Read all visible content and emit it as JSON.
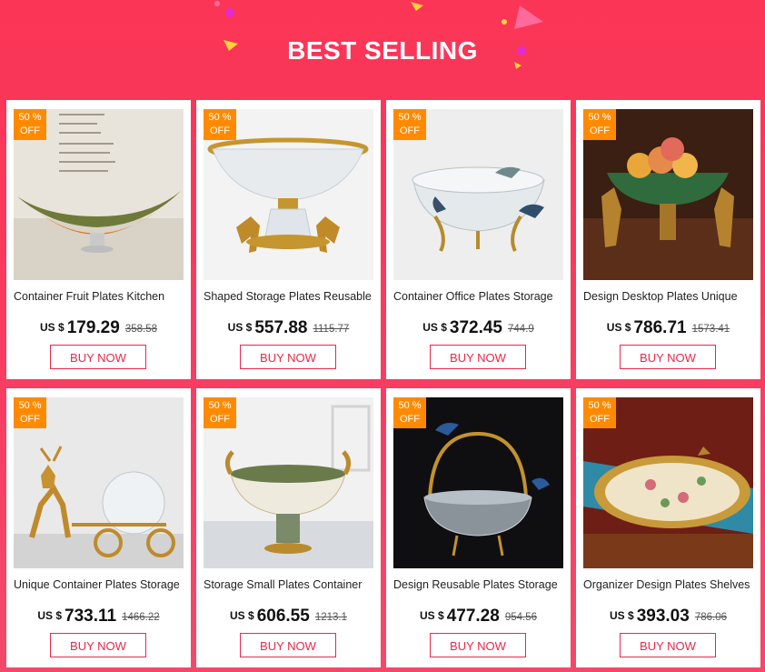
{
  "header": {
    "title": "BEST SELLING"
  },
  "products": [
    {
      "name": "Container Fruit Plates Kitchen",
      "currency": "US $",
      "price": "179.29",
      "old_price": "358.58",
      "discount": "50 %",
      "off": "OFF",
      "button": "BUY NOW"
    },
    {
      "name": "Shaped Storage Plates Reusable",
      "currency": "US $",
      "price": "557.88",
      "old_price": "1115.77",
      "discount": "50 %",
      "off": "OFF",
      "button": "BUY NOW"
    },
    {
      "name": "Container Office Plates Storage",
      "currency": "US $",
      "price": "372.45",
      "old_price": "744.9",
      "discount": "50 %",
      "off": "OFF",
      "button": "BUY NOW"
    },
    {
      "name": "Design Desktop Plates Unique",
      "currency": "US $",
      "price": "786.71",
      "old_price": "1573.41",
      "discount": "50 %",
      "off": "OFF",
      "button": "BUY NOW"
    },
    {
      "name": "Unique Container Plates Storage",
      "currency": "US $",
      "price": "733.11",
      "old_price": "1466.22",
      "discount": "50 %",
      "off": "OFF",
      "button": "BUY NOW"
    },
    {
      "name": "Storage Small Plates Container",
      "currency": "US $",
      "price": "606.55",
      "old_price": "1213.1",
      "discount": "50 %",
      "off": "OFF",
      "button": "BUY NOW"
    },
    {
      "name": "Design Reusable Plates Storage",
      "currency": "US $",
      "price": "477.28",
      "old_price": "954.56",
      "discount": "50 %",
      "off": "OFF",
      "button": "BUY NOW"
    },
    {
      "name": "Organizer Design Plates Shelves",
      "currency": "US $",
      "price": "393.03",
      "old_price": "786.06",
      "discount": "50 %",
      "off": "OFF",
      "button": "BUY NOW"
    }
  ],
  "colors": {
    "accent": "#e9284b",
    "badge": "#ff8a00",
    "background": "#fb3556"
  }
}
